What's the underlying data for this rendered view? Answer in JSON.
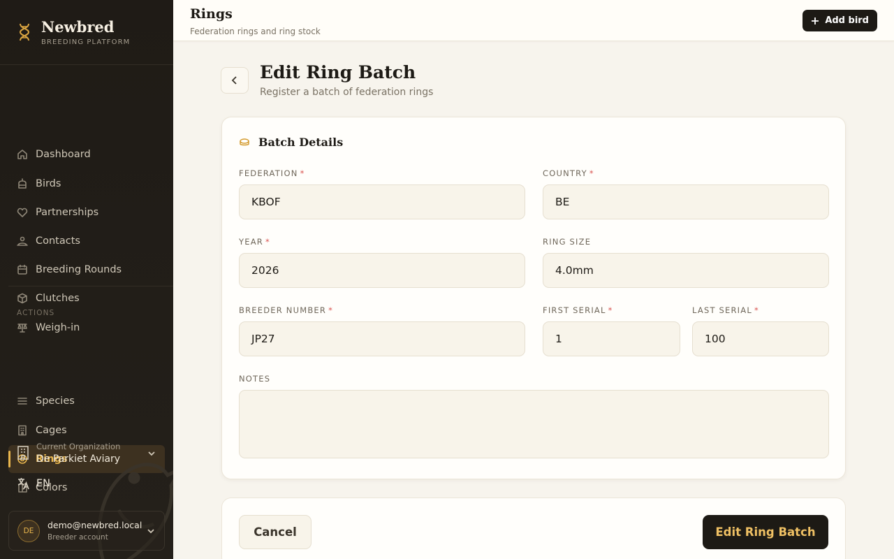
{
  "brand": {
    "name": "Newbred",
    "subtitle": "BREEDING PLATFORM"
  },
  "sidebar": {
    "items": [
      {
        "label": "Dashboard",
        "icon": "home-icon"
      },
      {
        "label": "Birds",
        "icon": "cage-icon"
      },
      {
        "label": "Partnerships",
        "icon": "heart-icon"
      },
      {
        "label": "Contacts",
        "icon": "users-icon"
      },
      {
        "label": "Breeding Rounds",
        "icon": "calendar-icon"
      },
      {
        "label": "Clutches",
        "icon": "box-icon"
      },
      {
        "label": "Weigh-in",
        "icon": "scale-icon"
      }
    ],
    "section_label": "ACTIONS",
    "action_items": [
      {
        "label": "Species",
        "icon": "list-icon"
      },
      {
        "label": "Cages",
        "icon": "building-icon"
      },
      {
        "label": "Rings",
        "icon": "ring-icon",
        "active": true
      },
      {
        "label": "Colors",
        "icon": "palette-icon"
      }
    ],
    "org": {
      "label": "Current Organization",
      "name": "De Parkiet Aviary"
    },
    "language": "EN",
    "account": {
      "initials": "DE",
      "email": "demo@newbred.local",
      "role": "Breeder account"
    }
  },
  "topbar": {
    "title": "Rings",
    "subtitle": "Federation rings and ring stock",
    "add_button": "Add bird"
  },
  "page": {
    "title": "Edit Ring Batch",
    "subtitle": "Register a batch of federation rings"
  },
  "card": {
    "title": "Batch Details"
  },
  "form": {
    "federation": {
      "label": "FEDERATION",
      "value": "KBOF",
      "required": "*"
    },
    "country": {
      "label": "COUNTRY",
      "value": "BE",
      "required": "*"
    },
    "year": {
      "label": "YEAR",
      "value": "2026",
      "required": "*"
    },
    "ring_size": {
      "label": "RING SIZE",
      "value": "4.0mm"
    },
    "breeder_number": {
      "label": "BREEDER NUMBER",
      "value": "JP27",
      "required": "*"
    },
    "first_serial": {
      "label": "FIRST SERIAL",
      "value": "1",
      "required": "*"
    },
    "last_serial": {
      "label": "LAST SERIAL",
      "value": "100",
      "required": "*"
    },
    "notes": {
      "label": "NOTES",
      "value": ""
    }
  },
  "actions": {
    "cancel": "Cancel",
    "submit": "Edit Ring Batch"
  },
  "colors": {
    "accent": "#e9b64d",
    "sidebar_bg": "#1f1b16",
    "dark_button": "#1d1a15",
    "required": "#d9534f"
  }
}
